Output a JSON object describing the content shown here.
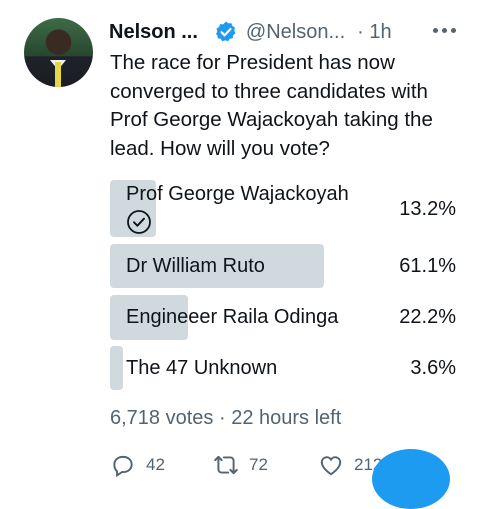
{
  "author": {
    "name": "Nelson ...",
    "handle": "@Nelson...",
    "time": "· 1h"
  },
  "tweet": {
    "text": "The race for President has now converged to three candidates with Prof George Wajackoyah taking the lead. How will you vote?"
  },
  "poll": {
    "options": [
      {
        "label": "Prof George Wajackoyah",
        "percent": "13.2%",
        "share": 0.132,
        "selected": true
      },
      {
        "label": "Dr William Ruto",
        "percent": "61.1%",
        "share": 0.611,
        "selected": false
      },
      {
        "label": "Engineeer Raila Odinga",
        "percent": "22.2%",
        "share": 0.222,
        "selected": false
      },
      {
        "label": "The 47 Unknown",
        "percent": "3.6%",
        "share": 0.036,
        "selected": false
      }
    ],
    "votes": "6,718 votes",
    "separator": "·",
    "time_left": "22 hours left"
  },
  "actions": {
    "replies": "42",
    "retweets": "72",
    "likes": "212"
  },
  "colors": {
    "accent": "#1d9bf0",
    "poll_bar": "#cfd9de",
    "secondary_text": "#536471",
    "primary_text": "#0f1419"
  },
  "icons": {
    "verified": "verified-badge-icon",
    "more": "more-dots-icon",
    "selected": "check-circle-icon",
    "reply": "reply-icon",
    "retweet": "retweet-icon",
    "like": "heart-icon"
  }
}
